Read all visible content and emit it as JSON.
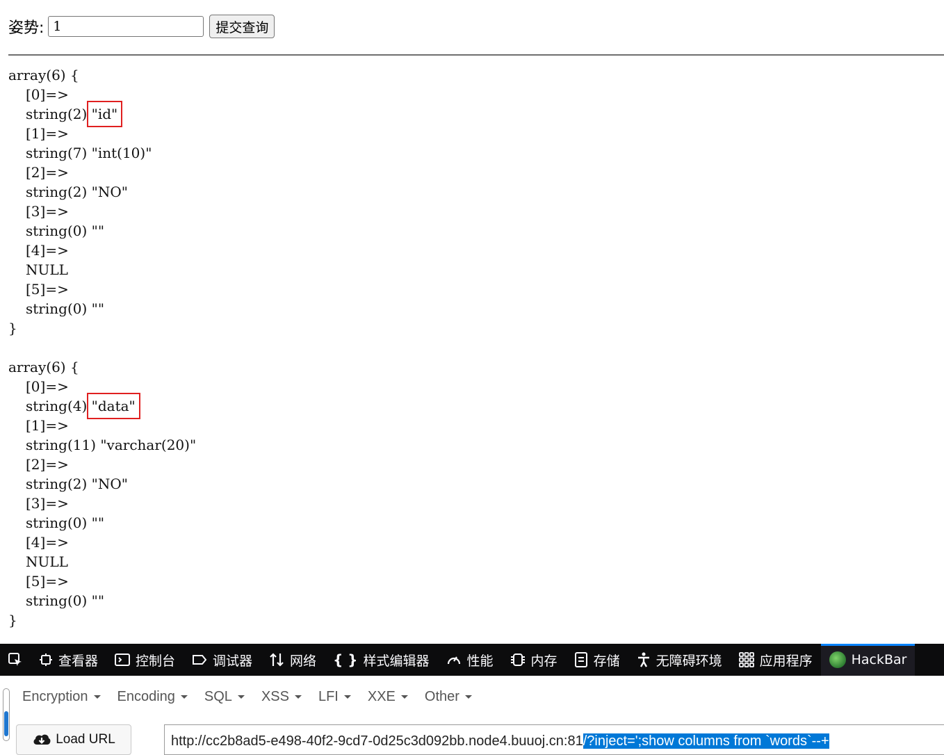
{
  "form": {
    "label": "姿势:",
    "input_value": "1",
    "submit_label": "提交查询"
  },
  "dump": {
    "blocks": [
      {
        "header": "array(6) {",
        "lines": [
          "[0]=>",
          "string(2) \"id\"",
          "[1]=>",
          "string(7) \"int(10)\"",
          "[2]=>",
          "string(2) \"NO\"",
          "[3]=>",
          "string(0) \"\"",
          "[4]=>",
          "NULL",
          "[5]=>",
          "string(0) \"\""
        ],
        "footer": "}",
        "highlight": {
          "prefix": "string(2) ",
          "value": "\"id\""
        }
      },
      {
        "header": "array(6) {",
        "lines": [
          "[0]=>",
          "string(4) \"data\"",
          "[1]=>",
          "string(11) \"varchar(20)\"",
          "[2]=>",
          "string(2) \"NO\"",
          "[3]=>",
          "string(0) \"\"",
          "[4]=>",
          "NULL",
          "[5]=>",
          "string(0) \"\""
        ],
        "footer": "}",
        "highlight": {
          "prefix": "string(4) ",
          "value": "\"data\""
        }
      }
    ]
  },
  "devtools": {
    "tabs": [
      {
        "icon": "inspector-icon",
        "label": "查看器"
      },
      {
        "icon": "console-icon",
        "label": "控制台"
      },
      {
        "icon": "debugger-icon",
        "label": "调试器"
      },
      {
        "icon": "network-icon",
        "label": "网络"
      },
      {
        "icon": "style-editor-icon",
        "label": "样式编辑器"
      },
      {
        "icon": "performance-icon",
        "label": "性能"
      },
      {
        "icon": "memory-icon",
        "label": "内存"
      },
      {
        "icon": "storage-icon",
        "label": "存储"
      },
      {
        "icon": "accessibility-icon",
        "label": "无障碍环境"
      },
      {
        "icon": "application-icon",
        "label": "应用程序"
      },
      {
        "icon": "hackbar-icon",
        "label": "HackBar",
        "active": true
      }
    ]
  },
  "hackbar": {
    "menu": [
      "Encryption",
      "Encoding",
      "SQL",
      "XSS",
      "LFI",
      "XXE",
      "Other"
    ],
    "load_url_label": "Load URL",
    "url_prefix": "http://cc2b8ad5-e498-40f2-9cd7-0d25c3d092bb.node4.buuoj.cn:81",
    "url_selected": "/?inject=';show columns from `words`--+"
  },
  "colors": {
    "highlight_box": "#e02020",
    "devtools_bg": "#0c0c0d",
    "active_tab_accent": "#0a84ff",
    "selection": "#0078d7"
  }
}
